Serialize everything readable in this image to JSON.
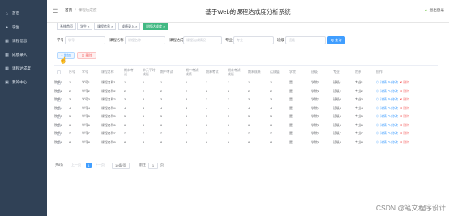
{
  "sidebar": {
    "items": [
      {
        "label": "首页",
        "icon": "home-icon",
        "glyph": "⌂"
      },
      {
        "label": "学生",
        "icon": "user-icon",
        "glyph": "●"
      },
      {
        "label": "课程信息",
        "icon": "grid-icon",
        "glyph": "▦"
      },
      {
        "label": "成绩录入",
        "icon": "grid-icon",
        "glyph": "▦"
      },
      {
        "label": "课程达成度",
        "icon": "grid-icon",
        "glyph": "▦"
      },
      {
        "label": "我的中心",
        "icon": "grid-icon",
        "glyph": "▣",
        "chevron": "⌄"
      }
    ]
  },
  "header": {
    "menu_glyph": "☰",
    "breadcrumb": {
      "home": "首页",
      "sep": "/",
      "current": "课程达成度"
    },
    "title": "基于Web的课程达成度分析系统",
    "user": {
      "glyph": "◐",
      "label": "退出登录"
    }
  },
  "tabs": [
    {
      "label": "系统首页",
      "active": false
    },
    {
      "label": "学生 ×",
      "active": false
    },
    {
      "label": "课程信息 ×",
      "active": false
    },
    {
      "label": "成绩录入 ×",
      "active": false
    },
    {
      "label": "课程达成度 ×",
      "active": true
    }
  ],
  "filters": {
    "xuehao": {
      "label": "学号",
      "placeholder": "学号"
    },
    "kechengmingcheng": {
      "label": "课程名称",
      "placeholder": "课程名称"
    },
    "dachengqingkuang": {
      "label": "课程达成",
      "placeholder": "课程达成情况"
    },
    "zhuanye": {
      "label": "专业",
      "placeholder": "专业"
    },
    "banji": {
      "label": "班级",
      "placeholder": "班级"
    },
    "search_label": "Q 查询"
  },
  "actions": {
    "add": "+ 增加",
    "delete": "⊗ 删除"
  },
  "table": {
    "headers": [
      "序号",
      "学号",
      "课程名称",
      "期末考试",
      "单元平时成绩",
      "期中考试",
      "期中考试成绩",
      "期末考试",
      "期末考试成绩",
      "期末成绩",
      "达成值",
      "学院",
      "班级",
      "专业",
      "院系",
      "操作"
    ],
    "rows": [
      [
        "1",
        "学号1",
        "课程名称1",
        "1",
        "1",
        "1",
        "1",
        "1",
        "1",
        "1",
        "1",
        "是",
        "学院1",
        "班级1",
        "专业1",
        "院系1"
      ],
      [
        "2",
        "学号2",
        "课程名称2",
        "2",
        "2",
        "2",
        "2",
        "2",
        "2",
        "2",
        "2",
        "是",
        "学院2",
        "班级2",
        "专业2",
        "院系2"
      ],
      [
        "3",
        "学号3",
        "课程名称3",
        "3",
        "3",
        "3",
        "3",
        "3",
        "3",
        "3",
        "3",
        "是",
        "学院3",
        "班级3",
        "专业3",
        "院系3"
      ],
      [
        "4",
        "学号4",
        "课程名称4",
        "4",
        "4",
        "4",
        "4",
        "4",
        "4",
        "4",
        "4",
        "是",
        "学院4",
        "班级4",
        "专业4",
        "院系4"
      ],
      [
        "5",
        "学号5",
        "课程名称5",
        "5",
        "5",
        "5",
        "5",
        "5",
        "5",
        "5",
        "5",
        "是",
        "学院5",
        "班级5",
        "专业5",
        "院系5"
      ],
      [
        "6",
        "学号6",
        "课程名称6",
        "6",
        "6",
        "6",
        "6",
        "6",
        "6",
        "6",
        "6",
        "是",
        "学院6",
        "班级6",
        "专业6",
        "院系6"
      ],
      [
        "7",
        "学号7",
        "课程名称7",
        "7",
        "7",
        "7",
        "7",
        "7",
        "7",
        "7",
        "7",
        "是",
        "学院7",
        "班级7",
        "专业7",
        "院系7"
      ],
      [
        "8",
        "学号8",
        "课程名称8",
        "8",
        "8",
        "8",
        "8",
        "8",
        "8",
        "8",
        "8",
        "是",
        "学院8",
        "班级8",
        "专业8",
        "院系8"
      ]
    ],
    "op": {
      "detail": "◎ 详情",
      "edit": "✎ 修改",
      "del": "✖ 删除"
    }
  },
  "pager": {
    "total": "共8条",
    "prev": "上一页",
    "page": "1",
    "next": "下一页",
    "size": "10条/页",
    "goto": "前往",
    "goto_value": "1",
    "goto_unit": "页"
  },
  "watermark": "CSDN @笔文程序设计",
  "colors": {
    "sidebar": "#304156",
    "accent": "#409eff",
    "active_tab": "#42b983",
    "danger": "#f56c6c"
  }
}
